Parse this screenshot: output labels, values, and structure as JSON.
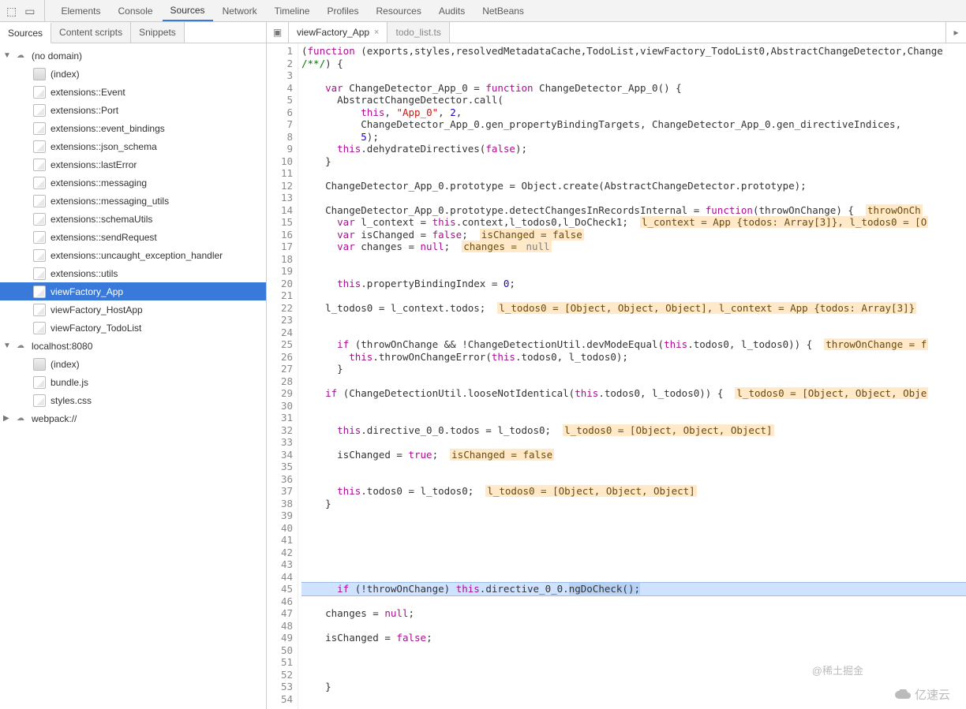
{
  "mainTabs": [
    "Elements",
    "Console",
    "Sources",
    "Network",
    "Timeline",
    "Profiles",
    "Resources",
    "Audits",
    "NetBeans"
  ],
  "activeMainTab": "Sources",
  "srcSubTabs": [
    "Sources",
    "Content scripts",
    "Snippets"
  ],
  "activeSrcSubTab": "Sources",
  "tree": [
    {
      "depth": 0,
      "arrow": "▼",
      "icon": "cloud",
      "label": "(no domain)"
    },
    {
      "depth": 1,
      "icon": "folder",
      "label": "(index)"
    },
    {
      "depth": 1,
      "icon": "file",
      "label": "extensions::Event"
    },
    {
      "depth": 1,
      "icon": "file",
      "label": "extensions::Port"
    },
    {
      "depth": 1,
      "icon": "file",
      "label": "extensions::event_bindings"
    },
    {
      "depth": 1,
      "icon": "file",
      "label": "extensions::json_schema"
    },
    {
      "depth": 1,
      "icon": "file",
      "label": "extensions::lastError"
    },
    {
      "depth": 1,
      "icon": "file",
      "label": "extensions::messaging"
    },
    {
      "depth": 1,
      "icon": "file",
      "label": "extensions::messaging_utils"
    },
    {
      "depth": 1,
      "icon": "file",
      "label": "extensions::schemaUtils"
    },
    {
      "depth": 1,
      "icon": "file",
      "label": "extensions::sendRequest"
    },
    {
      "depth": 1,
      "icon": "file",
      "label": "extensions::uncaught_exception_handler"
    },
    {
      "depth": 1,
      "icon": "file",
      "label": "extensions::utils"
    },
    {
      "depth": 1,
      "icon": "file",
      "label": "viewFactory_App",
      "selected": true
    },
    {
      "depth": 1,
      "icon": "file",
      "label": "viewFactory_HostApp"
    },
    {
      "depth": 1,
      "icon": "file",
      "label": "viewFactory_TodoList"
    },
    {
      "depth": 0,
      "arrow": "▼",
      "icon": "cloud",
      "label": "localhost:8080"
    },
    {
      "depth": 1,
      "icon": "folder",
      "label": "(index)"
    },
    {
      "depth": 1,
      "icon": "file",
      "label": "bundle.js"
    },
    {
      "depth": 1,
      "icon": "file",
      "label": "styles.css"
    },
    {
      "depth": 0,
      "arrow": "▶",
      "icon": "cloud",
      "label": "webpack://"
    }
  ],
  "openFiles": [
    {
      "name": "viewFactory_App",
      "active": true,
      "closable": true
    },
    {
      "name": "todo_list.ts",
      "active": false,
      "closable": false
    }
  ],
  "code": [
    {
      "n": 1,
      "t": [
        [
          "",
          "("
        ],
        [
          "kw",
          "function"
        ],
        [
          "",
          " (exports,styles,resolvedMetadataCache,TodoList,viewFactory_TodoList0,AbstractChangeDetector,Change"
        ]
      ]
    },
    {
      "n": 2,
      "t": [
        [
          "cmt",
          "/**/"
        ],
        [
          "",
          ") {"
        ]
      ]
    },
    {
      "n": 3,
      "t": [
        [
          "",
          ""
        ]
      ]
    },
    {
      "n": 4,
      "t": [
        [
          "",
          "    "
        ],
        [
          "kw",
          "var"
        ],
        [
          "",
          " ChangeDetector_App_0 = "
        ],
        [
          "kw",
          "function"
        ],
        [
          "",
          " ChangeDetector_App_0() {"
        ]
      ]
    },
    {
      "n": 5,
      "t": [
        [
          "",
          "      AbstractChangeDetector.call("
        ]
      ]
    },
    {
      "n": 6,
      "t": [
        [
          "",
          "          "
        ],
        [
          "kw",
          "this"
        ],
        [
          "",
          ", "
        ],
        [
          "str",
          "\"App_0\""
        ],
        [
          "",
          ", "
        ],
        [
          "num",
          "2"
        ],
        [
          "",
          ","
        ]
      ]
    },
    {
      "n": 7,
      "t": [
        [
          "",
          "          ChangeDetector_App_0.gen_propertyBindingTargets, ChangeDetector_App_0.gen_directiveIndices,"
        ]
      ]
    },
    {
      "n": 8,
      "t": [
        [
          "",
          "          "
        ],
        [
          "num",
          "5"
        ],
        [
          "",
          ");"
        ]
      ]
    },
    {
      "n": 9,
      "t": [
        [
          "",
          "      "
        ],
        [
          "kw",
          "this"
        ],
        [
          "",
          ".dehydrateDirectives("
        ],
        [
          "kw",
          "false"
        ],
        [
          "",
          ");"
        ]
      ]
    },
    {
      "n": 10,
      "t": [
        [
          "",
          "    }"
        ]
      ]
    },
    {
      "n": 11,
      "t": [
        [
          "",
          ""
        ]
      ]
    },
    {
      "n": 12,
      "t": [
        [
          "",
          "    ChangeDetector_App_0.prototype = Object.create(AbstractChangeDetector.prototype);"
        ]
      ]
    },
    {
      "n": 13,
      "t": [
        [
          "",
          ""
        ]
      ]
    },
    {
      "n": 14,
      "t": [
        [
          "",
          "    ChangeDetector_App_0.prototype.detectChangesInRecordsInternal = "
        ],
        [
          "kw",
          "function"
        ],
        [
          "",
          "(throwOnChange) {  "
        ],
        [
          "hl",
          "throwOnCh"
        ]
      ]
    },
    {
      "n": 15,
      "t": [
        [
          "",
          "      "
        ],
        [
          "kw",
          "var"
        ],
        [
          "",
          " l_context = "
        ],
        [
          "kw",
          "this"
        ],
        [
          "",
          ".context,l_todos0,l_DoCheck1;  "
        ],
        [
          "hl",
          "l_context = App {todos: Array[3]}, l_todos0 = [O"
        ]
      ]
    },
    {
      "n": 16,
      "t": [
        [
          "",
          "      "
        ],
        [
          "kw",
          "var"
        ],
        [
          "",
          " isChanged = "
        ],
        [
          "kw",
          "false"
        ],
        [
          "",
          ";  "
        ],
        [
          "hl",
          "isChanged = false"
        ]
      ]
    },
    {
      "n": 17,
      "t": [
        [
          "",
          "      "
        ],
        [
          "kw",
          "var"
        ],
        [
          "",
          " changes = "
        ],
        [
          "kw",
          "null"
        ],
        [
          "",
          ";  "
        ],
        [
          "hl",
          "changes = "
        ],
        [
          "hlnul",
          "null"
        ]
      ]
    },
    {
      "n": 18,
      "t": [
        [
          "",
          ""
        ]
      ]
    },
    {
      "n": 19,
      "t": [
        [
          "",
          ""
        ]
      ]
    },
    {
      "n": 20,
      "t": [
        [
          "",
          "      "
        ],
        [
          "kw",
          "this"
        ],
        [
          "",
          ".propertyBindingIndex = "
        ],
        [
          "num",
          "0"
        ],
        [
          "",
          ";"
        ]
      ]
    },
    {
      "n": 21,
      "t": [
        [
          "",
          ""
        ]
      ]
    },
    {
      "n": 22,
      "t": [
        [
          "",
          "    l_todos0 = l_context.todos;  "
        ],
        [
          "hl",
          "l_todos0 = [Object, Object, Object], l_context = App {todos: Array[3]}"
        ]
      ]
    },
    {
      "n": 23,
      "t": [
        [
          "",
          ""
        ]
      ]
    },
    {
      "n": 24,
      "t": [
        [
          "",
          ""
        ]
      ]
    },
    {
      "n": 25,
      "t": [
        [
          "",
          "      "
        ],
        [
          "kw",
          "if"
        ],
        [
          "",
          " (throwOnChange && !ChangeDetectionUtil.devModeEqual("
        ],
        [
          "kw",
          "this"
        ],
        [
          "",
          ".todos0, l_todos0)) {  "
        ],
        [
          "hl",
          "throwOnChange = f"
        ]
      ]
    },
    {
      "n": 26,
      "t": [
        [
          "",
          "        "
        ],
        [
          "kw",
          "this"
        ],
        [
          "",
          ".throwOnChangeError("
        ],
        [
          "kw",
          "this"
        ],
        [
          "",
          ".todos0, l_todos0);"
        ]
      ]
    },
    {
      "n": 27,
      "t": [
        [
          "",
          "      }"
        ]
      ]
    },
    {
      "n": 28,
      "t": [
        [
          "",
          ""
        ]
      ]
    },
    {
      "n": 29,
      "t": [
        [
          "",
          "    "
        ],
        [
          "kw",
          "if"
        ],
        [
          "",
          " (ChangeDetectionUtil.looseNotIdentical("
        ],
        [
          "kw",
          "this"
        ],
        [
          "",
          ".todos0, l_todos0)) {  "
        ],
        [
          "hl",
          "l_todos0 = [Object, Object, Obje"
        ]
      ]
    },
    {
      "n": 30,
      "t": [
        [
          "",
          ""
        ]
      ]
    },
    {
      "n": 31,
      "t": [
        [
          "",
          ""
        ]
      ]
    },
    {
      "n": 32,
      "t": [
        [
          "",
          "      "
        ],
        [
          "kw",
          "this"
        ],
        [
          "",
          ".directive_0_0.todos = l_todos0;  "
        ],
        [
          "hl",
          "l_todos0 = [Object, Object, Object]"
        ]
      ]
    },
    {
      "n": 33,
      "t": [
        [
          "",
          ""
        ]
      ]
    },
    {
      "n": 34,
      "t": [
        [
          "",
          "      isChanged = "
        ],
        [
          "kw",
          "true"
        ],
        [
          "",
          ";  "
        ],
        [
          "hl",
          "isChanged = false"
        ]
      ]
    },
    {
      "n": 35,
      "t": [
        [
          "",
          ""
        ]
      ]
    },
    {
      "n": 36,
      "t": [
        [
          "",
          ""
        ]
      ]
    },
    {
      "n": 37,
      "t": [
        [
          "",
          "      "
        ],
        [
          "kw",
          "this"
        ],
        [
          "",
          ".todos0 = l_todos0;  "
        ],
        [
          "hl",
          "l_todos0 = [Object, Object, Object]"
        ]
      ]
    },
    {
      "n": 38,
      "t": [
        [
          "",
          "    }"
        ]
      ]
    },
    {
      "n": 39,
      "t": [
        [
          "",
          ""
        ]
      ]
    },
    {
      "n": 40,
      "t": [
        [
          "",
          ""
        ]
      ]
    },
    {
      "n": 41,
      "t": [
        [
          "",
          ""
        ]
      ]
    },
    {
      "n": 42,
      "t": [
        [
          "",
          ""
        ]
      ]
    },
    {
      "n": 43,
      "t": [
        [
          "",
          ""
        ]
      ]
    },
    {
      "n": 44,
      "t": [
        [
          "",
          ""
        ]
      ]
    },
    {
      "n": 45,
      "hl": true,
      "t": [
        [
          "",
          "      "
        ],
        [
          "kw",
          "if"
        ],
        [
          "",
          " (!throwOnChange) "
        ],
        [
          "kw",
          "this"
        ],
        [
          "",
          ".directive_0_0."
        ],
        [
          "selblue",
          "ngDoCheck();"
        ]
      ]
    },
    {
      "n": 46,
      "t": [
        [
          "",
          ""
        ]
      ]
    },
    {
      "n": 47,
      "t": [
        [
          "",
          "    changes = "
        ],
        [
          "kw",
          "null"
        ],
        [
          "",
          ";"
        ]
      ]
    },
    {
      "n": 48,
      "t": [
        [
          "",
          ""
        ]
      ]
    },
    {
      "n": 49,
      "t": [
        [
          "",
          "    isChanged = "
        ],
        [
          "kw",
          "false"
        ],
        [
          "",
          ";"
        ]
      ]
    },
    {
      "n": 50,
      "t": [
        [
          "",
          ""
        ]
      ]
    },
    {
      "n": 51,
      "t": [
        [
          "",
          ""
        ]
      ]
    },
    {
      "n": 52,
      "t": [
        [
          "",
          ""
        ]
      ]
    },
    {
      "n": 53,
      "t": [
        [
          "",
          "    }"
        ]
      ]
    },
    {
      "n": 54,
      "t": [
        [
          "",
          ""
        ]
      ]
    }
  ],
  "watermarks": {
    "w1": "@稀土掘金",
    "w2": "亿速云"
  }
}
